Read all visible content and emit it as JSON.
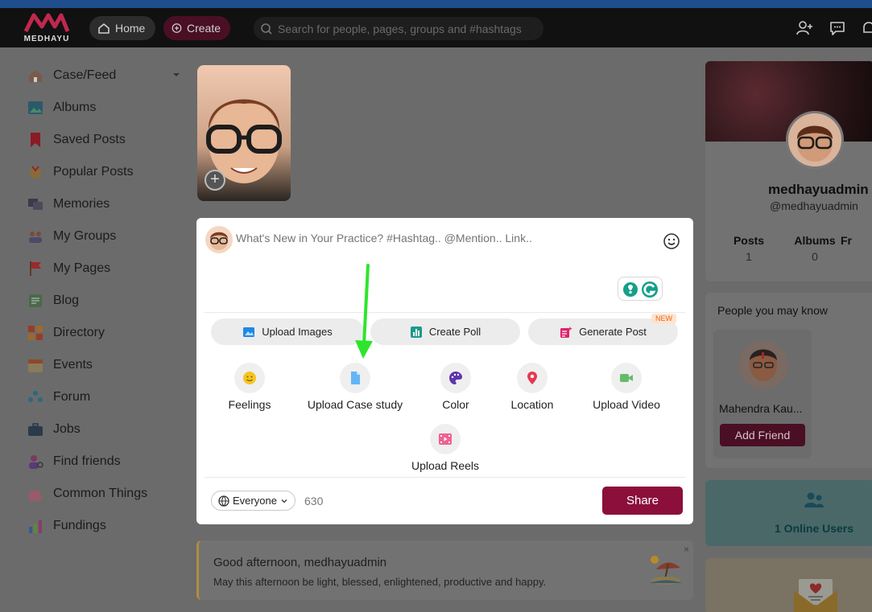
{
  "brand": {
    "name": "MEDHAYU"
  },
  "nav": {
    "home": "Home",
    "create": "Create"
  },
  "search": {
    "placeholder": "Search for people, pages, groups and #hashtags"
  },
  "sidebar": {
    "items": [
      {
        "label": "Case/Feed"
      },
      {
        "label": "Albums"
      },
      {
        "label": "Saved Posts"
      },
      {
        "label": "Popular Posts"
      },
      {
        "label": "Memories"
      },
      {
        "label": "My Groups"
      },
      {
        "label": "My Pages"
      },
      {
        "label": "Blog"
      },
      {
        "label": "Directory"
      },
      {
        "label": "Events"
      },
      {
        "label": "Forum"
      },
      {
        "label": "Jobs"
      },
      {
        "label": "Find friends"
      },
      {
        "label": "Common Things"
      },
      {
        "label": "Fundings"
      }
    ]
  },
  "composer": {
    "placeholder": "What's New in Your Practice? #Hashtag.. @Mention.. Link..",
    "upload_images": "Upload Images",
    "create_poll": "Create Poll",
    "generate_post": "Generate Post",
    "new_badge": "NEW",
    "options": {
      "feelings": "Feelings",
      "upload_case_study": "Upload Case study",
      "color": "Color",
      "location": "Location",
      "upload_video": "Upload Video",
      "upload_reels": "Upload Reels"
    },
    "privacy": "Everyone",
    "char_count": "630",
    "share": "Share"
  },
  "greeting": {
    "title": "Good afternoon, medhayuadmin",
    "subtitle": "May this afternoon be light, blessed, enlightened, productive and happy.",
    "close": "×"
  },
  "profile": {
    "name": "medhayuadmin",
    "handle": "@medhayuadmin",
    "stats": [
      {
        "label": "Posts",
        "value": "1"
      },
      {
        "label": "Albums",
        "value": "0"
      },
      {
        "label": "Fr",
        "value": ""
      }
    ]
  },
  "people_you_may_know": {
    "title": "People you may know",
    "person_name": "Mahendra Kau...",
    "add_friend": "Add Friend"
  },
  "online": {
    "text": "1 Online Users"
  },
  "colors": {
    "brand": "#8b0f3a",
    "accent_green": "#22cc22",
    "teal": "#2a8c8c"
  }
}
